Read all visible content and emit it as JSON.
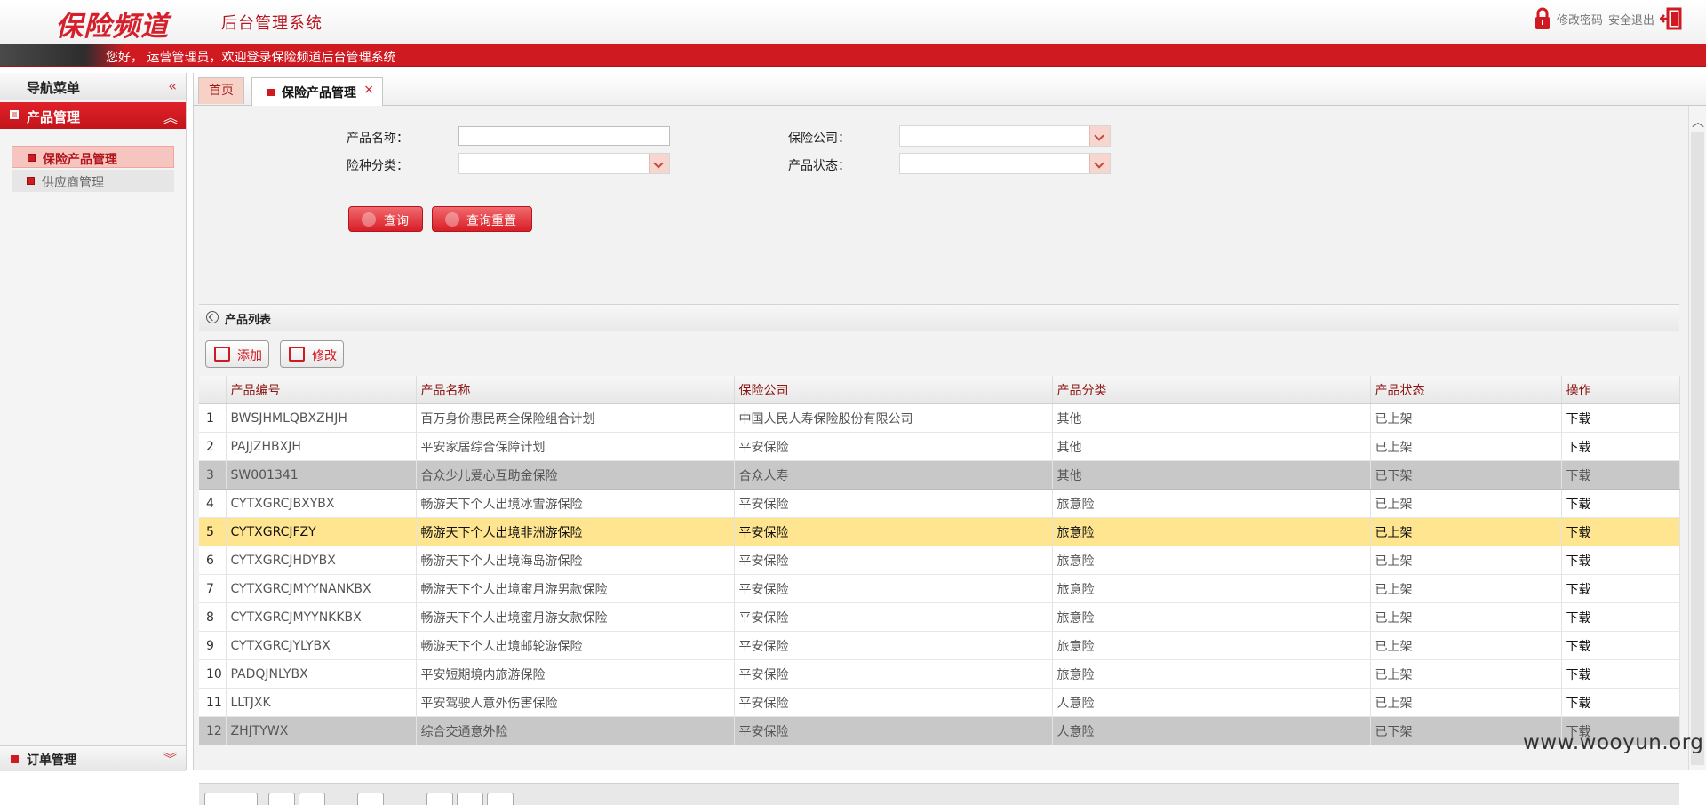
{
  "header": {
    "logo_text": "保险频道",
    "system_title": "后台管理系统",
    "change_password": "修改密码",
    "logout": "安全退出"
  },
  "welcome": "您好， 运营管理员，欢迎登录保险频道后台管理系统",
  "sidebar": {
    "nav_title": "导航菜单",
    "section_title": "产品管理",
    "items": [
      {
        "label": "保险产品管理",
        "active": true
      },
      {
        "label": "供应商管理",
        "active": false
      }
    ],
    "order_section": "订单管理"
  },
  "tabs": {
    "home": "首页",
    "current": "保险产品管理",
    "close": "×"
  },
  "search": {
    "product_name_label": "产品名称：",
    "company_label": "保险公司：",
    "category_label": "险种分类：",
    "status_label": "产品状态：",
    "query_button": "查询",
    "reset_button": "查询重置"
  },
  "list": {
    "title": "产品列表",
    "add_button": "添加",
    "edit_button": "修改",
    "columns": [
      "产品编号",
      "产品名称",
      "保险公司",
      "产品分类",
      "产品状态",
      "操作"
    ],
    "rows": [
      {
        "n": "1",
        "code": "BWSJHMLQBXZHJH",
        "name": "百万身价惠民两全保险组合计划",
        "company": "中国人民人寿保险股份有限公司",
        "category": "其他",
        "status": "已上架",
        "op": "下载",
        "style": "row"
      },
      {
        "n": "2",
        "code": "PAJJZHBXJH",
        "name": "平安家居综合保障计划",
        "company": "平安保险",
        "category": "其他",
        "status": "已上架",
        "op": "下载",
        "style": "row"
      },
      {
        "n": "3",
        "code": "SW001341",
        "name": "合众少儿爱心互助金保险",
        "company": "合众人寿",
        "category": "其他",
        "status": "已下架",
        "op": "下载",
        "style": "down"
      },
      {
        "n": "4",
        "code": "CYTXGRCJBXYBX",
        "name": "畅游天下个人出境冰雪游保险",
        "company": "平安保险",
        "category": "旅意险",
        "status": "已上架",
        "op": "下载",
        "style": "row"
      },
      {
        "n": "5",
        "code": "CYTXGRCJFZY",
        "name": "畅游天下个人出境非洲游保险",
        "company": "平安保险",
        "category": "旅意险",
        "status": "已上架",
        "op": "下载",
        "style": "hl"
      },
      {
        "n": "6",
        "code": "CYTXGRCJHDYBX",
        "name": "畅游天下个人出境海岛游保险",
        "company": "平安保险",
        "category": "旅意险",
        "status": "已上架",
        "op": "下载",
        "style": "row"
      },
      {
        "n": "7",
        "code": "CYTXGRCJMYYNANKBX",
        "name": "畅游天下个人出境蜜月游男款保险",
        "company": "平安保险",
        "category": "旅意险",
        "status": "已上架",
        "op": "下载",
        "style": "row"
      },
      {
        "n": "8",
        "code": "CYTXGRCJMYYNKKBX",
        "name": "畅游天下个人出境蜜月游女款保险",
        "company": "平安保险",
        "category": "旅意险",
        "status": "已上架",
        "op": "下载",
        "style": "row"
      },
      {
        "n": "9",
        "code": "CYTXGRCJYLYBX",
        "name": "畅游天下个人出境邮轮游保险",
        "company": "平安保险",
        "category": "旅意险",
        "status": "已上架",
        "op": "下载",
        "style": "row"
      },
      {
        "n": "10",
        "code": "PADQJNLYBX",
        "name": "平安短期境内旅游保险",
        "company": "平安保险",
        "category": "旅意险",
        "status": "已上架",
        "op": "下载",
        "style": "row"
      },
      {
        "n": "11",
        "code": "LLTJXK",
        "name": "平安驾驶人意外伤害保险",
        "company": "平安保险",
        "category": "人意险",
        "status": "已上架",
        "op": "下载",
        "style": "row"
      },
      {
        "n": "12",
        "code": "ZHJTYWX",
        "name": "综合交通意外险",
        "company": "平安保险",
        "category": "人意险",
        "status": "已下架",
        "op": "下载",
        "style": "down"
      }
    ]
  },
  "watermark": "www.wooyun.org",
  "colors": {
    "brand_red": "#d01a22",
    "highlight_row": "#ffe58f",
    "offline_row": "#c8c8c8"
  }
}
